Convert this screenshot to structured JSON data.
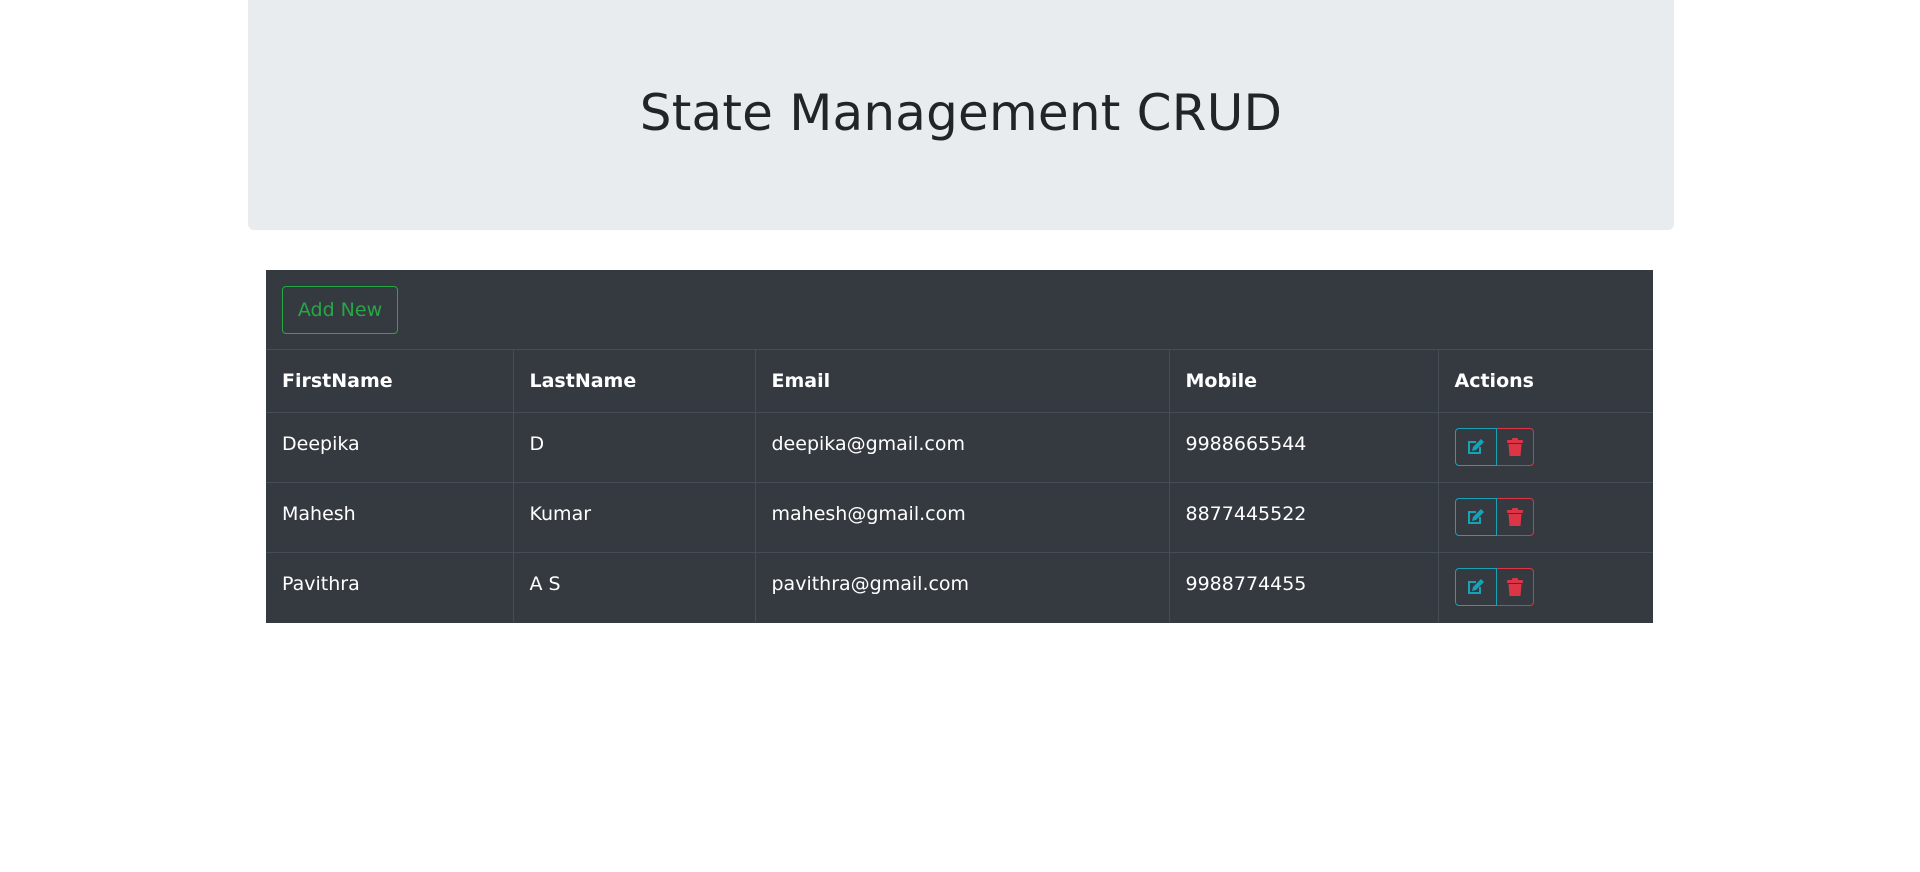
{
  "header": {
    "title": "State Management CRUD"
  },
  "toolbar": {
    "add_label": "Add New"
  },
  "table": {
    "columns": [
      "FirstName",
      "LastName",
      "Email",
      "Mobile",
      "Actions"
    ],
    "rows": [
      {
        "first": "Deepika",
        "last": "D",
        "email": "deepika@gmail.com",
        "mobile": "9988665544"
      },
      {
        "first": "Mahesh",
        "last": "Kumar",
        "email": "mahesh@gmail.com",
        "mobile": "8877445522"
      },
      {
        "first": "Pavithra",
        "last": "A S",
        "email": "pavithra@gmail.com",
        "mobile": "9988774455"
      }
    ]
  },
  "icons": {
    "edit": "edit-icon",
    "delete": "trash-icon"
  },
  "colors": {
    "success": "#28a745",
    "info": "#17a2b8",
    "danger": "#dc3545",
    "table_bg": "#343a40",
    "header_bg": "#e9ecef"
  }
}
